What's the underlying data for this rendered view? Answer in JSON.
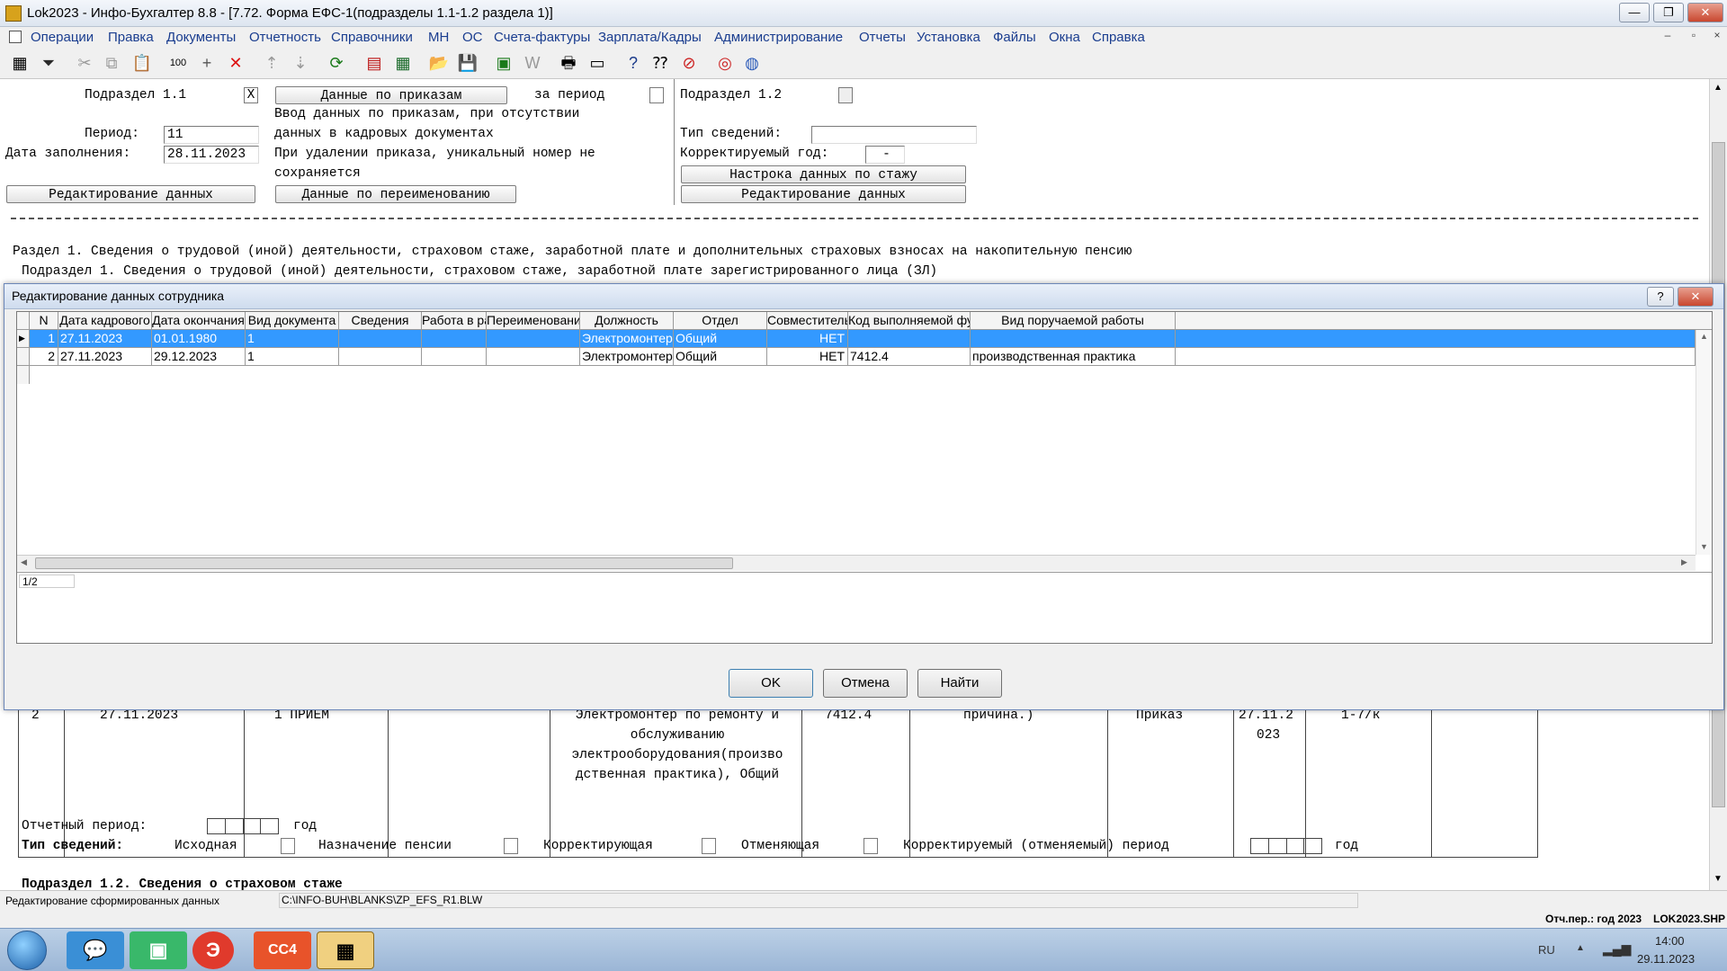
{
  "window": {
    "title": "Lok2023 - Инфо-Бухгалтер 8.8 - [7.72.    Форма ЕФС-1(подразделы 1.1-1.2 раздела 1)]",
    "minimize": "—",
    "restore": "❐",
    "close": "✕"
  },
  "menu": {
    "items": [
      "Операции",
      "Правка",
      "Документы",
      "Отчетность",
      "Справочники",
      "МН",
      "ОС",
      "Счета-фактуры",
      "Зарплата/Кадры",
      "Администрирование",
      "Отчеты",
      "Установка",
      "Файлы",
      "Окна",
      "Справка"
    ]
  },
  "form": {
    "sub11_label": "Подраздел 1.1",
    "sub11_check": "X",
    "orders_button": "Данные по приказам",
    "period_for_label": "за период",
    "info_line1": "Ввод данных по приказам, при отсутствии",
    "info_line2": "данных в кадровых документах",
    "info_line3": "При удалении приказа, уникальный номер не",
    "info_line4": "сохраняется",
    "period_label": "Период:",
    "period_value": "11",
    "date_label": "Дата заполнения:",
    "date_value": "28.11.2023",
    "edit_button_left": "Редактирование данных",
    "rename_button": "Данные по переименованию",
    "sub12_label": "Подраздел 1.2",
    "info_type_label": "Тип сведений:",
    "info_type_value": "",
    "corr_year_label": "Корректируемый год:",
    "corr_year_value": "-",
    "experience_button": "Настрока данных по стажу",
    "edit_button_right": "Редактирование данных",
    "section1_heading": "Раздел 1. Сведения о трудовой (иной) деятельности, страховом стаже, заработной плате и дополнительных страховых взносах на накопительную пенсию",
    "subsection1_heading": "Подраздел 1. Сведения о трудовой (иной) деятельности, страховом стаже, заработной плате зарегистрированного лица (ЗЛ)"
  },
  "behind_table": {
    "row_num": "2",
    "date_partial": "27.11.2023",
    "doc_partial": "1    ПРИЕМ",
    "position_lines": [
      "Электромонтер по ремонту и",
      "обслуживанию",
      "электрооборудования(произво",
      "дственная практика), Общий"
    ],
    "code_partial": "7412.4",
    "reason_partial": "причина.)",
    "basis_partial": "Приказ",
    "date2_line1": "27.11.2",
    "date2_line2": "023",
    "num_partial": "1-7/к"
  },
  "sub12": {
    "heading": "Подраздел 1.2. Сведения о страховом стаже",
    "report_period_label": "Отчетный период:",
    "year_label": "год",
    "info_type_label": "Тип сведений:",
    "opt_original": "Исходная",
    "opt_pension": "Назначение пенсии",
    "opt_corrective": "Корректирующая",
    "opt_cancel": "Отменяющая",
    "corrected_period_label": "Корректируемый (отменяемый) период",
    "year_label2": "год"
  },
  "dialog": {
    "title": "Редактирование данных сотрудника",
    "help": "?",
    "close": "✕",
    "columns": [
      "N",
      "Дата кадрового",
      "Дата окончания",
      "Вид документа",
      "Сведения",
      "Работа в ра",
      "Переименование",
      "Должность",
      "Отдел",
      "Совместитель",
      "Код выполняемой фун",
      "Вид поручаемой работы"
    ],
    "rows": [
      {
        "n": "1",
        "date_start": "27.11.2023",
        "date_end": "01.01.1980",
        "doc_type": "1",
        "info": "",
        "work": "",
        "rename": "",
        "position": "Электромонтер п",
        "dept": "Общий",
        "parttime": "НЕТ",
        "func_code": "",
        "work_kind": ""
      },
      {
        "n": "2",
        "date_start": "27.11.2023",
        "date_end": "29.12.2023",
        "doc_type": "1",
        "info": "",
        "work": "",
        "rename": "",
        "position": "Электромонтер п",
        "dept": "Общий",
        "parttime": "НЕТ",
        "func_code": "7412.4",
        "work_kind": "производственная практика"
      }
    ],
    "record_counter": "1/2",
    "ok": "OK",
    "cancel": "Отмена",
    "find": "Найти"
  },
  "status": {
    "left": "Редактирование сформированных данных",
    "path": "C:\\INFO-BUH\\BLANKS\\ZP_EFS_R1.BLW",
    "period": "Отч.пер.: год 2023",
    "file": "LOK2023.SHP"
  },
  "taskbar": {
    "lang": "RU",
    "time": "14:00",
    "date": "29.11.2023"
  },
  "colors": {
    "selection": "#3399ff",
    "menu_text": "#1a3d8f",
    "taskbar": "#9bb6d6"
  }
}
